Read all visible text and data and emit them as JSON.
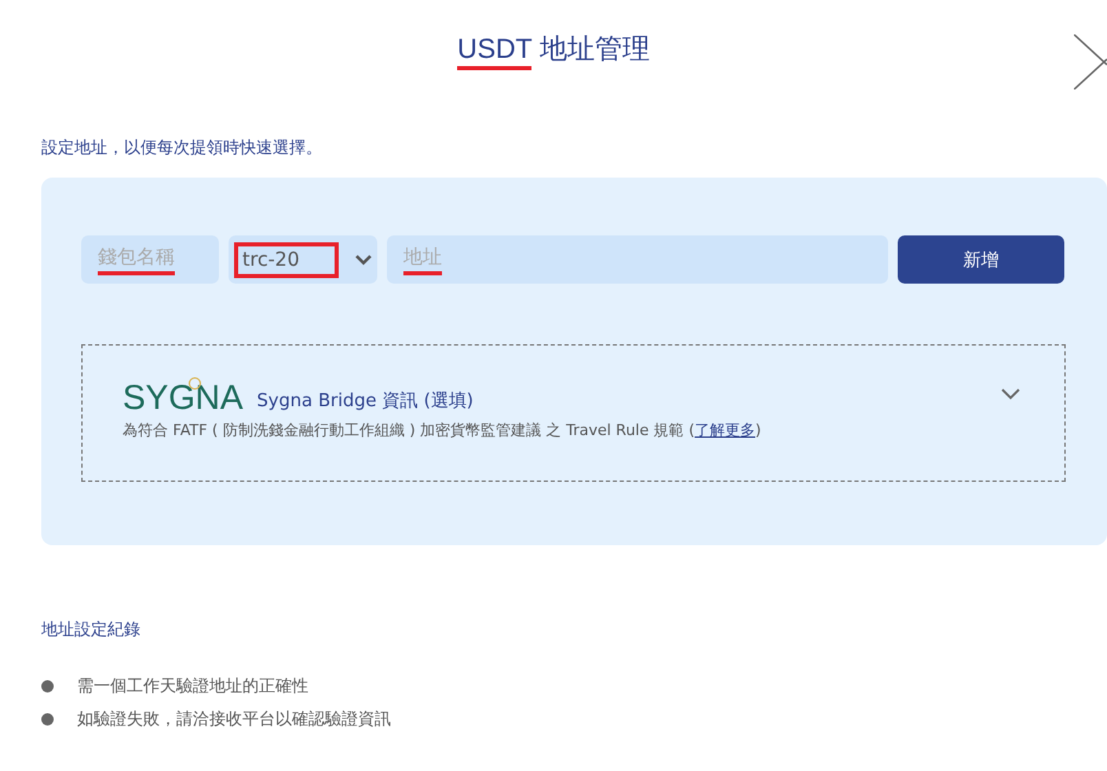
{
  "header": {
    "title_parts": [
      {
        "text": "USDT",
        "marked": true
      },
      {
        "text": "地址管理",
        "marked": false
      }
    ]
  },
  "intro": "設定地址，以便每次提領時快速選擇。",
  "form": {
    "name_field": {
      "placeholder": "錢包名稱",
      "marked": true
    },
    "network_select": {
      "value": "trc-20",
      "marked": true
    },
    "address_field": {
      "placeholder": "地址",
      "marked": true
    },
    "add_button": "新增"
  },
  "sygna": {
    "logo": "SYGNA",
    "title": "Sygna Bridge 資訊 (選填)",
    "note": "為符合 FATF ( 防制洗錢金融行動工作組織 ) 加密貨幣監管建議 之 Travel Rule 規範 (",
    "link": "了解更多",
    "note_end": ")",
    "expanded": false
  },
  "records": {
    "heading": "地址設定紀錄",
    "notes": [
      "需一個工作天驗證地址的正確性",
      "如驗證失敗，請洽接收平台以確認驗證資訊"
    ]
  }
}
